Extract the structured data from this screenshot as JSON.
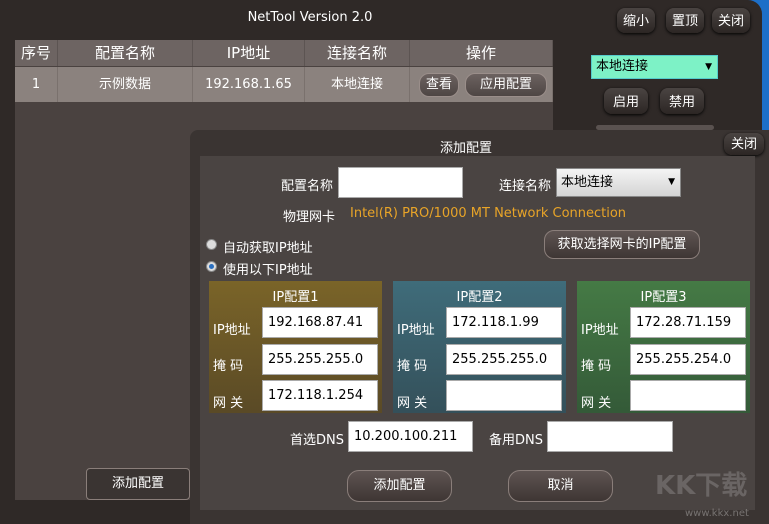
{
  "window": {
    "title": "NetTool Version 2.0",
    "buttons": {
      "minimize": "缩小",
      "pin": "置顶",
      "close": "关闭"
    }
  },
  "table": {
    "headers": [
      "序号",
      "配置名称",
      "IP地址",
      "连接名称",
      "操作"
    ],
    "rows": [
      {
        "index": "1",
        "name": "示例数据",
        "ip": "192.168.1.65",
        "connection": "本地连接",
        "view": "查看",
        "apply": "应用配置"
      }
    ]
  },
  "side": {
    "connection_select": "本地连接",
    "enable": "启用",
    "disable": "禁用"
  },
  "add_config_button": "添加配置",
  "dialog": {
    "title": "添加配置",
    "close": "关闭",
    "config_name_label": "配置名称",
    "config_name_value": "",
    "connection_label": "连接名称",
    "connection_value": "本地连接",
    "nic_label": "物理网卡",
    "nic_value": "Intel(R) PRO/1000 MT Network Connection",
    "radio_auto": "自动获取IP地址",
    "radio_manual": "使用以下IP地址",
    "radio_selected": "manual",
    "fetch_button": "获取选择网卡的IP配置",
    "ip_configs": [
      {
        "title": "IP配置1",
        "ip_label": "IP地址",
        "mask_label": "掩 码",
        "gw_label": "网 关",
        "ip": "192.168.87.41",
        "mask": "255.255.255.0",
        "gateway": "172.118.1.254",
        "color": "#6e5a28"
      },
      {
        "title": "IP配置2",
        "ip_label": "IP地址",
        "mask_label": "掩 码",
        "gw_label": "网 关",
        "ip": "172.118.1.99",
        "mask": "255.255.255.0",
        "gateway": "",
        "color": "#3a6470"
      },
      {
        "title": "IP配置3",
        "ip_label": "IP地址",
        "mask_label": "掩 码",
        "gw_label": "网 关",
        "ip": "172.28.71.159",
        "mask": "255.255.254.0",
        "gateway": "",
        "color": "#3e6e40"
      }
    ],
    "dns1_label": "首选DNS",
    "dns1": "10.200.100.211",
    "dns2_label": "备用DNS",
    "dns2": "",
    "add": "添加配置",
    "cancel": "取消"
  },
  "watermark": {
    "logo": "KK下载",
    "url": "www.kkx.net"
  }
}
